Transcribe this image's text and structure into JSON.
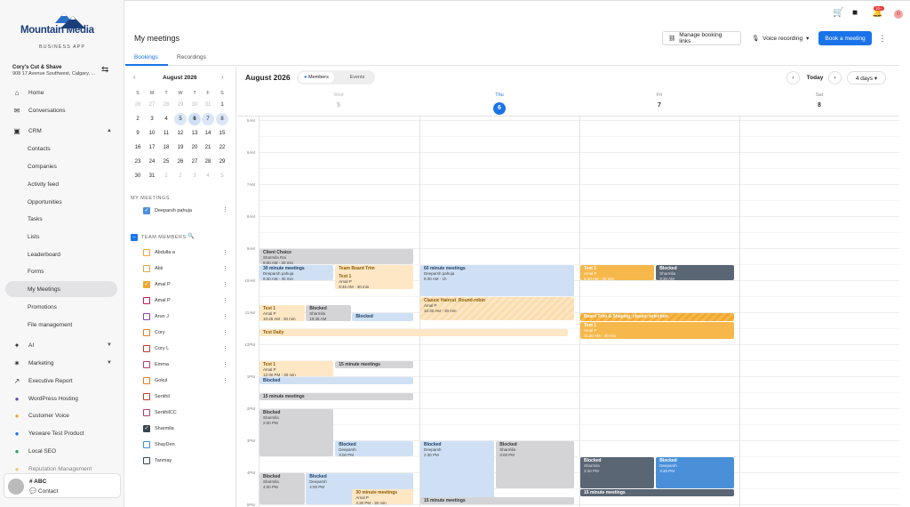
{
  "brand": {
    "name": "Mountain Media",
    "sub": "BUSINESS APP"
  },
  "location": {
    "name": "Cory's Cut & Shave",
    "address": "908 17 Avenue Southwest, Calgary, ..."
  },
  "nav": [
    {
      "label": "Home",
      "icon": "home-icon",
      "glyph": "⌂"
    },
    {
      "label": "Conversations",
      "icon": "chat-icon",
      "glyph": "✉"
    },
    {
      "label": "CRM",
      "icon": "contacts-icon",
      "glyph": "▣",
      "chev": "▲"
    },
    {
      "label": "AI",
      "icon": "sparkle-icon",
      "glyph": "✦",
      "chev": "▼"
    },
    {
      "label": "Marketing",
      "icon": "megaphone-icon",
      "glyph": "✷",
      "chev": "▼"
    },
    {
      "label": "Executive Report",
      "icon": "trend-icon",
      "glyph": "↗"
    },
    {
      "label": "WordPress Hosting",
      "icon": "wordpress-icon",
      "glyph": "●"
    },
    {
      "label": "Customer Voice",
      "icon": "voice-icon",
      "glyph": "●"
    },
    {
      "label": "Yesware Test Product",
      "icon": "yesware-icon",
      "glyph": "●"
    },
    {
      "label": "Local SEO",
      "icon": "pin-icon",
      "glyph": "●"
    },
    {
      "label": "Reputation Management",
      "icon": "star-icon",
      "glyph": "●"
    }
  ],
  "crm_items": [
    "Contacts",
    "Companies",
    "Activity feed",
    "Opportunities",
    "Tasks",
    "Lists",
    "Leaderboard",
    "Forms",
    "My Meetings",
    "Promotions",
    "File management"
  ],
  "user": {
    "name": "# ABC",
    "sub": "Contact"
  },
  "header": {
    "title": "My meetings",
    "manage": "Manage booking links",
    "voice": "Voice recording",
    "book": "Book a meeting",
    "more": "⋮"
  },
  "tabs": [
    "Bookings",
    "Recordings"
  ],
  "mini": {
    "month": "August 2026",
    "prev": "‹",
    "next": "›",
    "dows": [
      "S",
      "M",
      "T",
      "W",
      "T",
      "F",
      "S"
    ],
    "weeks": [
      [
        "26",
        "27",
        "28",
        "29",
        "30",
        "31",
        "1"
      ],
      [
        "2",
        "3",
        "4",
        "5",
        "6",
        "7",
        "8"
      ],
      [
        "9",
        "10",
        "11",
        "12",
        "13",
        "14",
        "15"
      ],
      [
        "16",
        "17",
        "18",
        "19",
        "20",
        "21",
        "22"
      ],
      [
        "23",
        "24",
        "25",
        "26",
        "27",
        "28",
        "29"
      ],
      [
        "30",
        "31",
        "1",
        "2",
        "3",
        "4",
        "5"
      ]
    ]
  },
  "my_meetings": {
    "header": "MY MEETINGS",
    "name": "Deeparsh pahuja"
  },
  "team": {
    "header": "TEAM MEMBERS",
    "members": [
      {
        "name": "Abdulla a",
        "color": "#f0a830",
        "checked": false
      },
      {
        "name": "Abii",
        "color": "#d9a84b",
        "checked": false
      },
      {
        "name": "Amal P",
        "color": "#f0a830",
        "checked": true
      },
      {
        "name": "Amal P",
        "color": "#c2185b",
        "checked": false
      },
      {
        "name": "Arun J",
        "color": "#8e44ad",
        "checked": false
      },
      {
        "name": "Cory",
        "color": "#e67e22",
        "checked": false
      },
      {
        "name": "Cory L",
        "color": "#c0392b",
        "checked": false
      },
      {
        "name": "Emma",
        "color": "#b03a7a",
        "checked": false
      },
      {
        "name": "Gokul",
        "color": "#e67e22",
        "checked": false
      },
      {
        "name": "Senthil",
        "color": "#c0392b",
        "checked": false
      },
      {
        "name": "SenthilCC",
        "color": "#b03a7a",
        "checked": false
      },
      {
        "name": "Sharmila",
        "color": "#37474f",
        "checked": true
      },
      {
        "name": "ShayDen",
        "color": "#3a8fd9",
        "checked": false
      },
      {
        "name": "Tanmay",
        "color": "#37474f",
        "checked": false
      }
    ]
  },
  "cal": {
    "title": "August 2026",
    "members": "Members",
    "events": "Events",
    "today": "Today",
    "view": "4 days ▾",
    "prev": "‹",
    "next": "›",
    "days": [
      {
        "dn": "Wed",
        "dd": "5"
      },
      {
        "dn": "Thu",
        "dd": "6"
      },
      {
        "dn": "Fri",
        "dd": "7"
      },
      {
        "dn": "Sat",
        "dd": "8"
      }
    ],
    "hours": [
      "5AM",
      "6AM",
      "7AM",
      "8AM",
      "9AM",
      "10AM",
      "11AM",
      "12PM",
      "1PM",
      "2PM",
      "3PM",
      "4PM",
      "5PM"
    ]
  },
  "events": [
    {
      "day": 0,
      "start": 9.0,
      "end": 9.5,
      "col": 0,
      "w": 1,
      "cls": "ev-gray",
      "t": "Client Choice",
      "s": "Sharmila Rai",
      "s2": "9:00 AM - 30 min"
    },
    {
      "day": 0,
      "start": 9.5,
      "end": 10.0,
      "col": 0,
      "w": 0.48,
      "cls": "ev-blue",
      "t": "30 minute meetings",
      "s": "Deeparsh pahuja",
      "s2": "9:30 AM - 30 min"
    },
    {
      "day": 0,
      "start": 9.5,
      "end": 10.3,
      "col": 0.49,
      "w": 0.51,
      "cls": "ev-orange",
      "t": "Team Board Trim",
      "s": "",
      "s2": ""
    },
    {
      "day": 0,
      "start": 9.75,
      "end": 10.3,
      "col": 0.49,
      "w": 0.51,
      "cls": "ev-orange",
      "t": "Test 1",
      "s": "Amal P",
      "s2": "9:45 AM - 30 min"
    },
    {
      "day": 0,
      "start": 10.75,
      "end": 11.3,
      "col": 0,
      "w": 0.3,
      "cls": "ev-orange",
      "t": "Test 1",
      "s": "Amal P",
      "s2": "10:45 AM - 30 min"
    },
    {
      "day": 0,
      "start": 10.75,
      "end": 11.3,
      "col": 0.3,
      "w": 0.3,
      "cls": "ev-gray",
      "t": "Blocked",
      "s": "Sharmila",
      "s2": "10:45 AM"
    },
    {
      "day": 0,
      "start": 11.0,
      "end": 11.3,
      "col": 0.6,
      "w": 0.4,
      "cls": "ev-blue",
      "t": "Blocked",
      "s": "",
      "s2": ""
    },
    {
      "day": 0,
      "start": 11.5,
      "end": 11.75,
      "col": 0,
      "w": 2,
      "cls": "ev-orange",
      "t": "Test Daily",
      "s": "",
      "s2": ""
    },
    {
      "day": 0,
      "start": 12.5,
      "end": 13.0,
      "col": 0,
      "w": 0.48,
      "cls": "ev-orange",
      "t": "Test 1",
      "s": "Amal P",
      "s2": "12:30 PM - 30 min"
    },
    {
      "day": 0,
      "start": 12.5,
      "end": 12.75,
      "col": 0.49,
      "w": 0.51,
      "cls": "ev-gray",
      "t": "15 minute meetings",
      "s": "",
      "s2": ""
    },
    {
      "day": 0,
      "start": 13.0,
      "end": 13.25,
      "col": 0,
      "w": 1,
      "cls": "ev-blue",
      "t": "Blocked",
      "s": "",
      "s2": ""
    },
    {
      "day": 0,
      "start": 13.5,
      "end": 13.75,
      "col": 0,
      "w": 1,
      "cls": "ev-gray",
      "t": "15 minute meetings",
      "s": "",
      "s2": ""
    },
    {
      "day": 0,
      "start": 14.0,
      "end": 15.5,
      "col": 0,
      "w": 0.48,
      "cls": "ev-gray",
      "t": "Blocked",
      "s": "Sharmila",
      "s2": "2:00 PM"
    },
    {
      "day": 0,
      "start": 15.0,
      "end": 15.5,
      "col": 0.49,
      "w": 0.51,
      "cls": "ev-blue",
      "t": "Blocked",
      "s": "Deeparsh",
      "s2": "3:00 PM"
    },
    {
      "day": 0,
      "start": 16.0,
      "end": 17.0,
      "col": 0,
      "w": 0.3,
      "cls": "ev-gray",
      "t": "Blocked",
      "s": "Sharmila",
      "s2": "4:00 PM"
    },
    {
      "day": 0,
      "start": 16.0,
      "end": 17.0,
      "col": 0.3,
      "w": 0.7,
      "cls": "ev-blue",
      "t": "Blocked",
      "s": "Deeparsh",
      "s2": "4:00 PM"
    },
    {
      "day": 0,
      "start": 16.5,
      "end": 17.0,
      "col": 0.6,
      "w": 0.4,
      "cls": "ev-orange",
      "t": "30 minute meetings",
      "s": "Amal P",
      "s2": "4:30 PM - 30 min"
    },
    {
      "day": 1,
      "start": 9.5,
      "end": 10.5,
      "col": 0,
      "w": 1,
      "cls": "ev-blue",
      "t": "60 minute meetings",
      "s": "Deeparsh pahuja",
      "s2": "9:30 AM - 1h"
    },
    {
      "day": 1,
      "start": 10.5,
      "end": 11.25,
      "col": 0,
      "w": 1,
      "cls": "ev-stripe",
      "t": "Classic Haircut_Round-robin",
      "s": "Amal P",
      "s2": "10:30 AM - 30 min"
    },
    {
      "day": 1,
      "start": 15.0,
      "end": 17.0,
      "col": 0,
      "w": 0.48,
      "cls": "ev-blue",
      "t": "Blocked",
      "s": "Deeparsh",
      "s2": "2:30 PM"
    },
    {
      "day": 1,
      "start": 15.0,
      "end": 16.5,
      "col": 0.49,
      "w": 0.51,
      "cls": "ev-gray",
      "t": "Blocked",
      "s": "Sharmila",
      "s2": "3:00 PM"
    },
    {
      "day": 1,
      "start": 16.75,
      "end": 17.0,
      "col": 0,
      "w": 1,
      "cls": "ev-gray",
      "t": "15 minute meetings",
      "s": "",
      "s2": ""
    },
    {
      "day": 2,
      "start": 9.5,
      "end": 10.0,
      "col": 0,
      "w": 0.48,
      "cls": "ev-yellow",
      "t": "Test 1",
      "s": "Amal P",
      "s2": "9:30 AM - 30 min"
    },
    {
      "day": 2,
      "start": 9.5,
      "end": 10.0,
      "col": 0.49,
      "w": 0.51,
      "cls": "ev-dark",
      "t": "Blocked",
      "s": "Sharmila",
      "s2": "9:30 AM"
    },
    {
      "day": 2,
      "start": 11.0,
      "end": 11.3,
      "col": 0,
      "w": 1,
      "cls": "ev-ystripe",
      "t": "Beard Trim & Shaping_classic selection",
      "s": "",
      "s2": ""
    },
    {
      "day": 2,
      "start": 11.3,
      "end": 11.85,
      "col": 0,
      "w": 1,
      "cls": "ev-yellow",
      "t": "Test 1",
      "s": "Amal P",
      "s2": "11:30 AM - 30 min"
    },
    {
      "day": 2,
      "start": 15.5,
      "end": 16.5,
      "col": 0,
      "w": 0.48,
      "cls": "ev-dark",
      "t": "Blocked",
      "s": "Sharmila",
      "s2": "3:30 PM"
    },
    {
      "day": 2,
      "start": 15.5,
      "end": 16.5,
      "col": 0.49,
      "w": 0.51,
      "cls": "ev-mid",
      "t": "Blocked",
      "s": "Deeparsh",
      "s2": "3:30 PM"
    },
    {
      "day": 2,
      "start": 16.5,
      "end": 16.75,
      "col": 0,
      "w": 1,
      "cls": "ev-dark",
      "t": "15 minute meetings",
      "s": "",
      "s2": ""
    }
  ]
}
